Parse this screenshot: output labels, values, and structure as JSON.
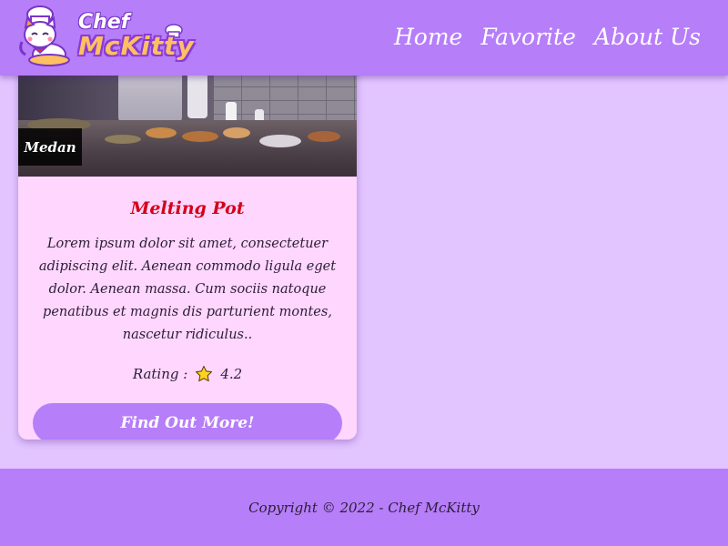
{
  "header": {
    "logo_line1": "Chef",
    "logo_line2": "McKitty",
    "nav": [
      "Home",
      "Favorite",
      "About Us"
    ]
  },
  "card": {
    "city": "Medan",
    "title": "Melting Pot",
    "description": "Lorem ipsum dolor sit amet, consectetuer adipiscing elit. Aenean commodo ligula eget dolor. Aenean massa. Cum sociis natoque penatibus et magnis dis parturient montes, nascetur ridiculus..",
    "rating_label": "Rating :",
    "rating_value": "4.2",
    "rating_icon": "star-icon",
    "cta_label": "Find Out More!"
  },
  "footer": {
    "copyright": "Copyright © 2022 - Chef McKitty"
  },
  "colors": {
    "header_bg": "#b67ef9",
    "page_bg": "#e2c4ff",
    "card_bg": "#fed6fe",
    "title_red": "#d4001a",
    "button_bg": "#b67ef9"
  }
}
